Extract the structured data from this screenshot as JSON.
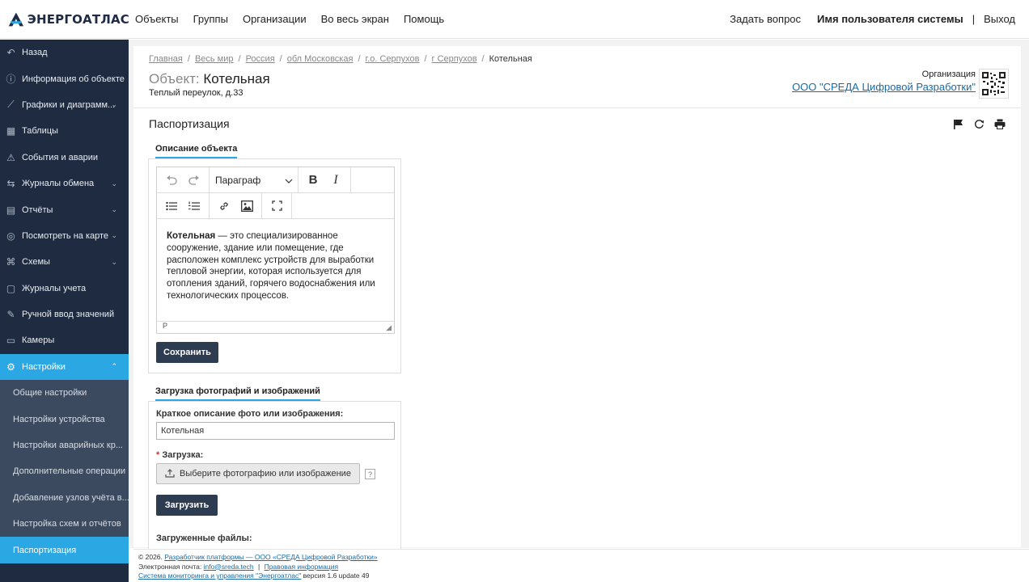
{
  "brand": {
    "name": "ЭНЕРГОАТЛАС"
  },
  "topnav": [
    "Объекты",
    "Группы",
    "Организации",
    "Во весь экран",
    "Помощь"
  ],
  "topright": {
    "ask": "Задать вопрос",
    "user": "Имя пользователя системы",
    "sep": "|",
    "logout": "Выход"
  },
  "sidebar": {
    "items": [
      {
        "label": "Назад",
        "icon": "back-arrow-icon",
        "glyph": "↶",
        "chev": ""
      },
      {
        "label": "Информация об объекте",
        "icon": "info-icon",
        "glyph": "ⓘ",
        "chev": ""
      },
      {
        "label": "Графики и диаграмм...",
        "icon": "line-chart-icon",
        "glyph": "⟋",
        "chev": "⌄"
      },
      {
        "label": "Таблицы",
        "icon": "table-icon",
        "glyph": "▦",
        "chev": ""
      },
      {
        "label": "События и аварии",
        "icon": "warning-icon",
        "glyph": "⚠",
        "chev": ""
      },
      {
        "label": "Журналы обмена",
        "icon": "exchange-icon",
        "glyph": "⇆",
        "chev": "⌄"
      },
      {
        "label": "Отчёты",
        "icon": "report-icon",
        "glyph": "▤",
        "chev": "⌄"
      },
      {
        "label": "Посмотреть на карте",
        "icon": "compass-icon",
        "glyph": "◎",
        "chev": "⌄"
      },
      {
        "label": "Схемы",
        "icon": "scheme-icon",
        "glyph": "⌘",
        "chev": "⌄"
      },
      {
        "label": "Журналы учета",
        "icon": "book-icon",
        "glyph": "▢",
        "chev": ""
      },
      {
        "label": "Ручной ввод значений",
        "icon": "edit-icon",
        "glyph": "✎",
        "chev": ""
      },
      {
        "label": "Камеры",
        "icon": "camera-icon",
        "glyph": "▭",
        "chev": ""
      },
      {
        "label": "Настройки",
        "icon": "gear-icon",
        "glyph": "⚙",
        "chev": "⌃"
      }
    ],
    "subitems": [
      "Общие настройки",
      "Настройки устройства",
      "Настройки аварийных кр...",
      "Дополнительные операции",
      "Добавление узлов учёта в...",
      "Настройка схем и отчётов",
      "Паспортизация"
    ]
  },
  "breadcrumb": {
    "links": [
      "Главная",
      "Весь мир",
      "Россия",
      "обл Московская",
      "г.о. Серпухов",
      "г Серпухов"
    ],
    "current": "Котельная",
    "sep": "/"
  },
  "object": {
    "label": "Объект:",
    "name": "Котельная",
    "address": "Теплый переулок, д.33"
  },
  "organization": {
    "label": "Организация",
    "name": "ООО \"СРЕДА Цифровой Разработки\""
  },
  "section": {
    "title": "Паспортизация"
  },
  "description": {
    "tab": "Описание объекта",
    "toolbar": {
      "paragraph": "Параграф",
      "bold": "B",
      "italic": "I"
    },
    "body_bold": "Котельная",
    "body_text": " — это специализированное сооружение, здание или помещение, где расположен комплекс устройств для выработки тепловой энергии, которая используется для отопления зданий, горячего водоснабжения или технологических процессов.",
    "status": "P",
    "save": "Сохранить"
  },
  "photos": {
    "tab": "Загрузка фотографий и изображений",
    "desc_label": "Краткое описание фото или изображения:",
    "desc_value": "Котельная",
    "upload_label": "Загрузка:",
    "req": "*",
    "choose": "Выберите фотографию или изображение",
    "help": "?",
    "upload_btn": "Загрузить",
    "uploaded": "Загруженные файлы:"
  },
  "footer": {
    "copyright": "© 2026.",
    "dev_link": "Разработчик платформы — ООО «СРЕДА Цифровой Разработки»",
    "email_label": "Электронная почта:",
    "email": "info@sreda.tech",
    "sep": "|",
    "legal": "Правовая информация",
    "system": "Система мониторинга и управления \"Энергоатлас\"",
    "version": "версия 1.6 update 49"
  }
}
